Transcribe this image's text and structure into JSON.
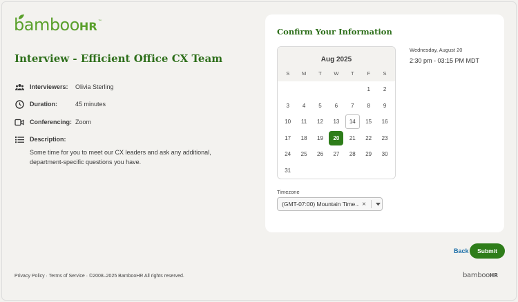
{
  "brand": {
    "logo_word": "bamboo",
    "logo_hr": "HR",
    "logo_tm": "™"
  },
  "event": {
    "title": "Interview - Efficient Office CX Team",
    "interviewers_label": "Interviewers:",
    "interviewers_value": "Olivia Sterling",
    "duration_label": "Duration:",
    "duration_value": "45 minutes",
    "conferencing_label": "Conferencing:",
    "conferencing_value": "Zoom",
    "description_label": "Description:",
    "description_value": "Some time for you to meet our CX leaders and ask any additional, department-specific questions you have."
  },
  "confirm": {
    "title": "Confirm Your Information",
    "calendar": {
      "month": "Aug 2025",
      "weekdays": [
        "S",
        "M",
        "T",
        "W",
        "T",
        "F",
        "S"
      ],
      "first_weekday_index": 5,
      "days_in_month": 31,
      "today": 14,
      "selected": 20
    },
    "selected_date": "Wednesday, August 20",
    "selected_time": "2:30 pm - 03:15 PM MDT",
    "timezone_label": "Timezone",
    "timezone_value": "(GMT-07:00) Mountain Time..."
  },
  "actions": {
    "back": "Back",
    "submit": "Submit"
  },
  "footer": {
    "privacy": "Privacy Policy",
    "sep1": " · ",
    "terms": "Terms of Service",
    "copyright": " · ©2008–2025 BambooHR All rights reserved."
  },
  "colors": {
    "brand_green": "#2e7d1a",
    "title_green": "#2e6f1b",
    "logo_green": "#5aa02c",
    "link_blue": "#1a6ea8"
  },
  "icons": [
    "leaf-icon",
    "people-icon",
    "clock-icon",
    "video-icon",
    "list-icon",
    "close-icon",
    "chevron-down-icon"
  ]
}
